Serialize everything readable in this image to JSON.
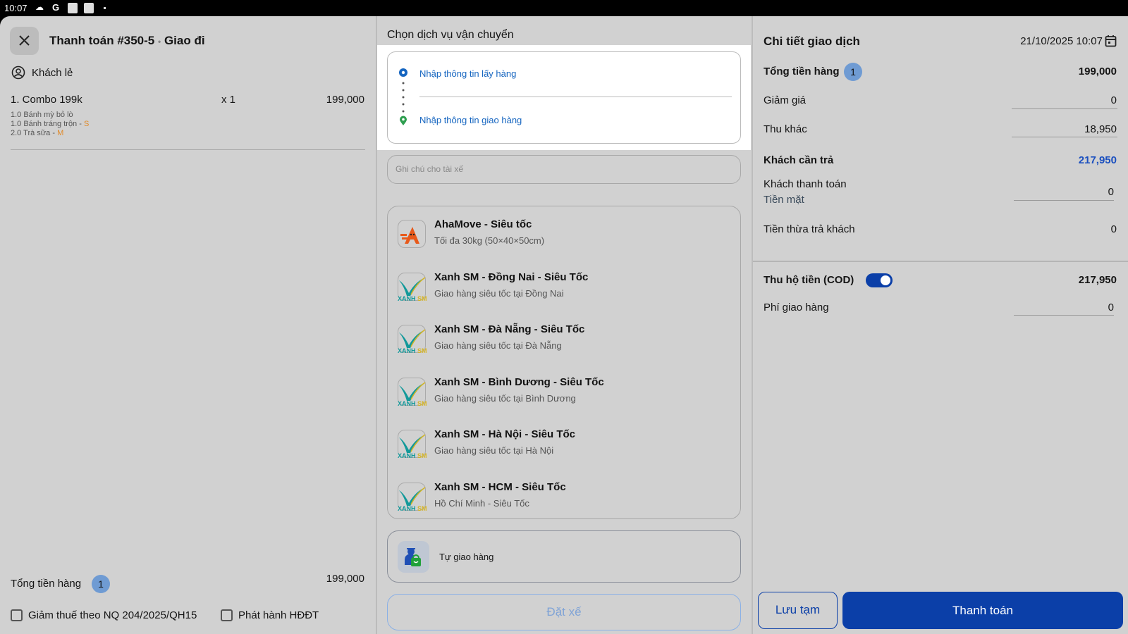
{
  "status": {
    "time": "10:07"
  },
  "left": {
    "title": "Thanh toán #350-5",
    "separator": "•",
    "mode": "Giao đi",
    "customer": "Khách lẻ",
    "item": {
      "name": "1. Combo 199k",
      "qty": "x 1",
      "price": "199,000",
      "subs": [
        {
          "text": "1.0 Bánh mỳ bỏ lò",
          "size": ""
        },
        {
          "text": "1.0 Bánh tráng trộn - ",
          "size": "S"
        },
        {
          "text": "2.0 Trà sữa - ",
          "size": "M"
        }
      ]
    },
    "total_label": "Tổng tiền hàng",
    "total_count": "1",
    "total_value": "199,000",
    "checkbox1": "Giảm thuế theo NQ 204/2025/QH15",
    "checkbox2": "Phát hành HĐĐT"
  },
  "middle": {
    "title": "Chọn dịch vụ vận chuyển",
    "pickup": "Nhập thông tin lấy hàng",
    "dropoff": "Nhập thông tin giao hàng",
    "note_placeholder": "Ghi chú cho tài xế",
    "services": [
      {
        "title": "AhaMove - Siêu tốc",
        "desc": "Tối đa 30kg (50×40×50cm)",
        "logo": "ahamove"
      },
      {
        "title": "Xanh SM - Đồng Nai - Siêu Tốc",
        "desc": "Giao hàng siêu tốc tại Đồng Nai",
        "logo": "xanhsm"
      },
      {
        "title": "Xanh SM - Đà Nẵng - Siêu Tốc",
        "desc": "Giao hàng siêu tốc tại Đà Nẵng",
        "logo": "xanhsm"
      },
      {
        "title": "Xanh SM - Bình Dương - Siêu Tốc",
        "desc": "Giao hàng siêu tốc tại Bình Dương",
        "logo": "xanhsm"
      },
      {
        "title": "Xanh SM - Hà Nội - Siêu Tốc",
        "desc": "Giao hàng siêu tốc tại Hà Nội",
        "logo": "xanhsm"
      },
      {
        "title": "Xanh SM - HCM - Siêu Tốc",
        "desc": "Hồ Chí Minh - Siêu Tốc",
        "logo": "xanhsm"
      }
    ],
    "self_delivery": "Tự giao hàng",
    "book_button": "Đặt xế"
  },
  "right": {
    "title": "Chi tiết giao dịch",
    "datetime": "21/10/2025 10:07",
    "subtotal_label": "Tổng tiền hàng",
    "subtotal_count": "1",
    "subtotal": "199,000",
    "discount_label": "Giảm giá",
    "discount": "0",
    "other_label": "Thu khác",
    "other": "18,950",
    "due_label": "Khách cần trả",
    "due": "217,950",
    "paid_label": "Khách thanh toán",
    "paid_method": "Tiền mặt",
    "paid": "0",
    "change_label": "Tiền thừa trả khách",
    "change": "0",
    "cod_label": "Thu hộ tiền (COD)",
    "cod_enabled": true,
    "cod": "217,950",
    "ship_fee_label": "Phí giao hàng",
    "ship_fee": "0",
    "save_button": "Lưu tạm",
    "pay_button": "Thanh toán"
  },
  "colors": {
    "primary": "#0b3fa8",
    "accent_blue": "#1a4fbf",
    "badge": "#6f9bd3"
  }
}
